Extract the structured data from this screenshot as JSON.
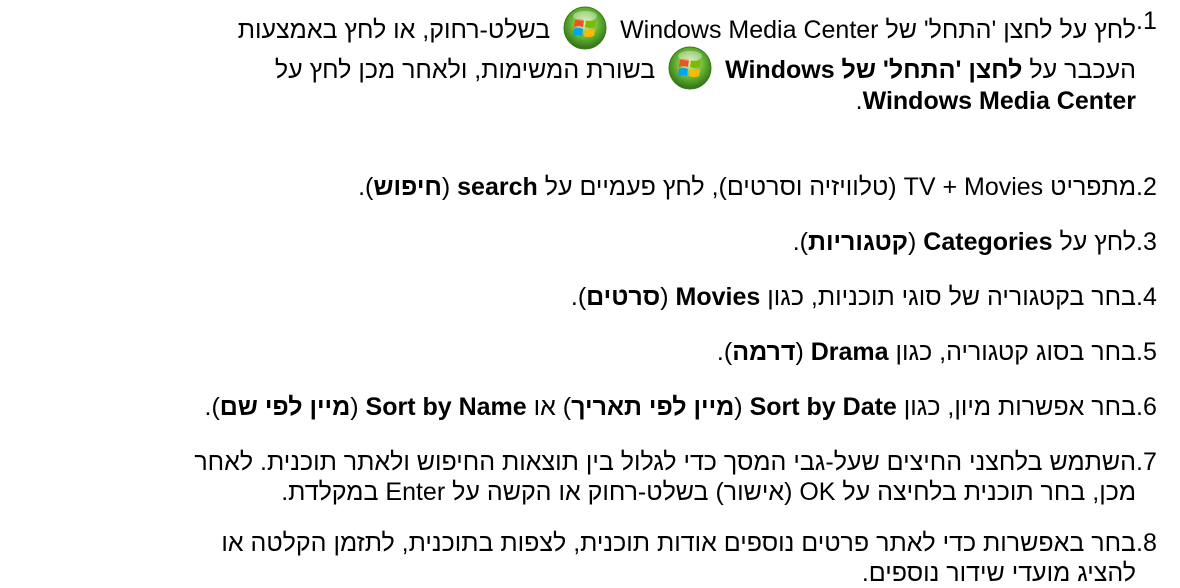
{
  "steps": [
    {
      "num": ".1",
      "p1": "לחץ על לחצן 'התחל' של Windows Media Center",
      "p2": "בשלט-רחוק, או לחץ באמצעות",
      "line2a": "העכבר על",
      "line2b": "לחצן 'התחל' של Windows",
      "line2c": "בשורת המשימות, ולאחר מכן לחץ על",
      "line3a": "Windows Media Center",
      "line3b": "."
    },
    {
      "num": ".2",
      "a": "מתפריט TV + Movies (טלוויזיה וסרטים), לחץ פעמיים על",
      "b": "search",
      "c": " (",
      "d": "חיפוש",
      "e": ")."
    },
    {
      "num": ".3",
      "a": "לחץ על",
      "b": "Categories",
      "c": " (",
      "d": "קטגוריות",
      "e": ")."
    },
    {
      "num": ".4",
      "a": "בחר בקטגוריה של סוגי תוכניות, כגון",
      "b": "Movies",
      "c": " (",
      "d": "סרטים",
      "e": ")."
    },
    {
      "num": ".5",
      "a": "בחר בסוג קטגוריה, כגון",
      "b": "Drama",
      "c": " (",
      "d": "דרמה",
      "e": ")."
    },
    {
      "num": ".6",
      "a": "בחר אפשרות מיון, כגון",
      "b": "Sort by Date",
      "c": " (",
      "d": "מיין לפי תאריך",
      "e": ") או",
      "f": "Sort by Name",
      "g": " (",
      "h": "מיין לפי שם",
      "i": ")."
    },
    {
      "num": ".7",
      "line1": "השתמש בלחצני החיצים שעל-גבי המסך כדי לגלול בין תוצאות החיפוש ולאתר תוכנית. לאחר",
      "line2": "מכן, בחר תוכנית בלחיצה על OK (אישור) בשלט-רחוק או הקשה על Enter במקלדת."
    },
    {
      "num": ".8",
      "line1": "בחר באפשרות כדי לאתר פרטים נוספים אודות תוכנית, לצפות בתוכנית, לתזמן הקלטה או",
      "line2": "להציג מועדי שידור נוספים."
    }
  ]
}
